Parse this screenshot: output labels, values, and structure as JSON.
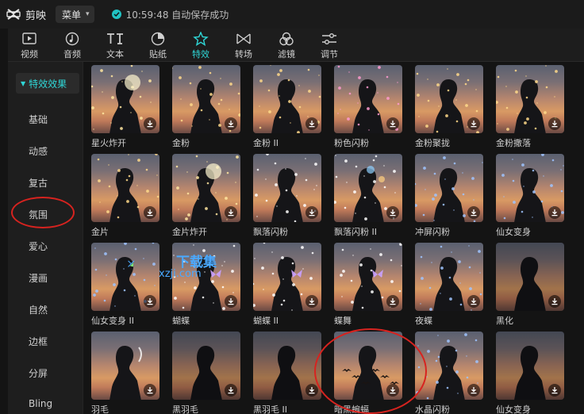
{
  "app": {
    "name": "剪映",
    "menu_label": "菜单",
    "save_status": "10:59:48 自动保存成功"
  },
  "toolbar": [
    {
      "label": "视频",
      "icon": "video-icon"
    },
    {
      "label": "音频",
      "icon": "audio-icon"
    },
    {
      "label": "文本",
      "icon": "text-icon"
    },
    {
      "label": "贴纸",
      "icon": "sticker-icon"
    },
    {
      "label": "特效",
      "icon": "effects-icon",
      "active": true
    },
    {
      "label": "转场",
      "icon": "transition-icon"
    },
    {
      "label": "滤镜",
      "icon": "filter-icon"
    },
    {
      "label": "调节",
      "icon": "adjust-icon"
    }
  ],
  "sidebar": {
    "header": "特效效果",
    "items": [
      "基础",
      "动感",
      "复古",
      "氛围",
      "爱心",
      "漫画",
      "自然",
      "边框",
      "分屏",
      "Bling"
    ],
    "selected": "氛围"
  },
  "effects": [
    [
      "星火炸开",
      "金粉",
      "金粉 II",
      "粉色闪粉",
      "金粉聚拢",
      "金粉撒落"
    ],
    [
      "金片",
      "金片炸开",
      "飘落闪粉",
      "飘落闪粉 II",
      "冲屏闪粉",
      "仙女变身"
    ],
    [
      "仙女变身 II",
      "蝴蝶",
      "蝴蝶 II",
      "蝶舞",
      "夜蝶",
      "黑化"
    ],
    [
      "羽毛",
      "黑羽毛",
      "黑羽毛 II",
      "暗黑蝙蝠",
      "水晶闪粉",
      "仙女变身"
    ]
  ],
  "watermark": {
    "main": "下载集",
    "sub": "xzji.com"
  },
  "colors": {
    "accent": "#2fd7d7",
    "annotation": "#d7231f"
  }
}
